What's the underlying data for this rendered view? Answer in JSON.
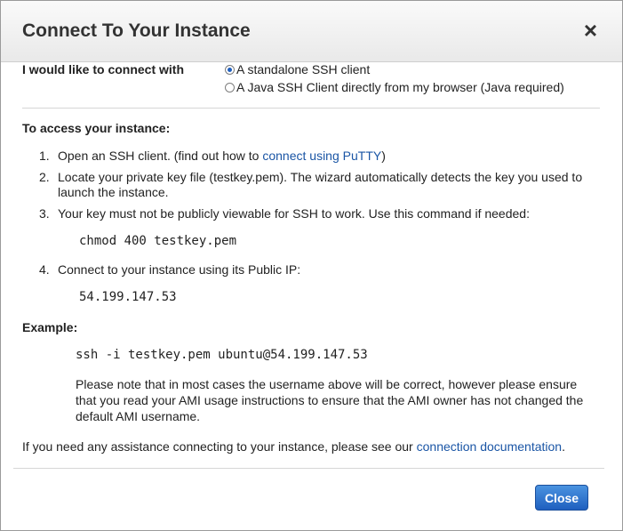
{
  "dialog": {
    "title": "Connect To Your Instance",
    "close_symbol": "×"
  },
  "connect_with": {
    "label": "I would like to connect with",
    "options": [
      {
        "label": "A standalone SSH client",
        "selected": true
      },
      {
        "label": "A Java SSH Client directly from my browser (Java required)",
        "selected": false
      }
    ]
  },
  "access": {
    "title": "To access your instance:",
    "steps": [
      {
        "num": "1.",
        "text_before": "Open an SSH client. (find out how to ",
        "link": "connect using PuTTY",
        "text_after": ")"
      },
      {
        "num": "2.",
        "line1": "Locate your private key file (testkey.pem). The wizard automatically detects the key you used to",
        "line2": "launch the instance."
      },
      {
        "num": "3.",
        "text": "Your key must not be publicly viewable for SSH to work. Use this command if needed:"
      },
      {
        "num": "4.",
        "text": "Connect to your instance using its Public IP:"
      }
    ],
    "chmod_command": "chmod 400 testkey.pem",
    "public_ip": "54.199.147.53"
  },
  "example": {
    "title": "Example:",
    "command": "ssh -i testkey.pem ubuntu@54.199.147.53",
    "note_lines": [
      "Please note that in most cases the username above will be correct, however please ensure",
      "that you read your AMI usage instructions to ensure that the AMI owner has not changed the",
      "default AMI username."
    ]
  },
  "help": {
    "text_before": "If you need any assistance connecting to your instance, please see our ",
    "link": "connection documentation",
    "text_after": "."
  },
  "footer": {
    "close_label": "Close"
  },
  "colors": {
    "link": "#1a55a5",
    "button": "#1f5fbf"
  }
}
